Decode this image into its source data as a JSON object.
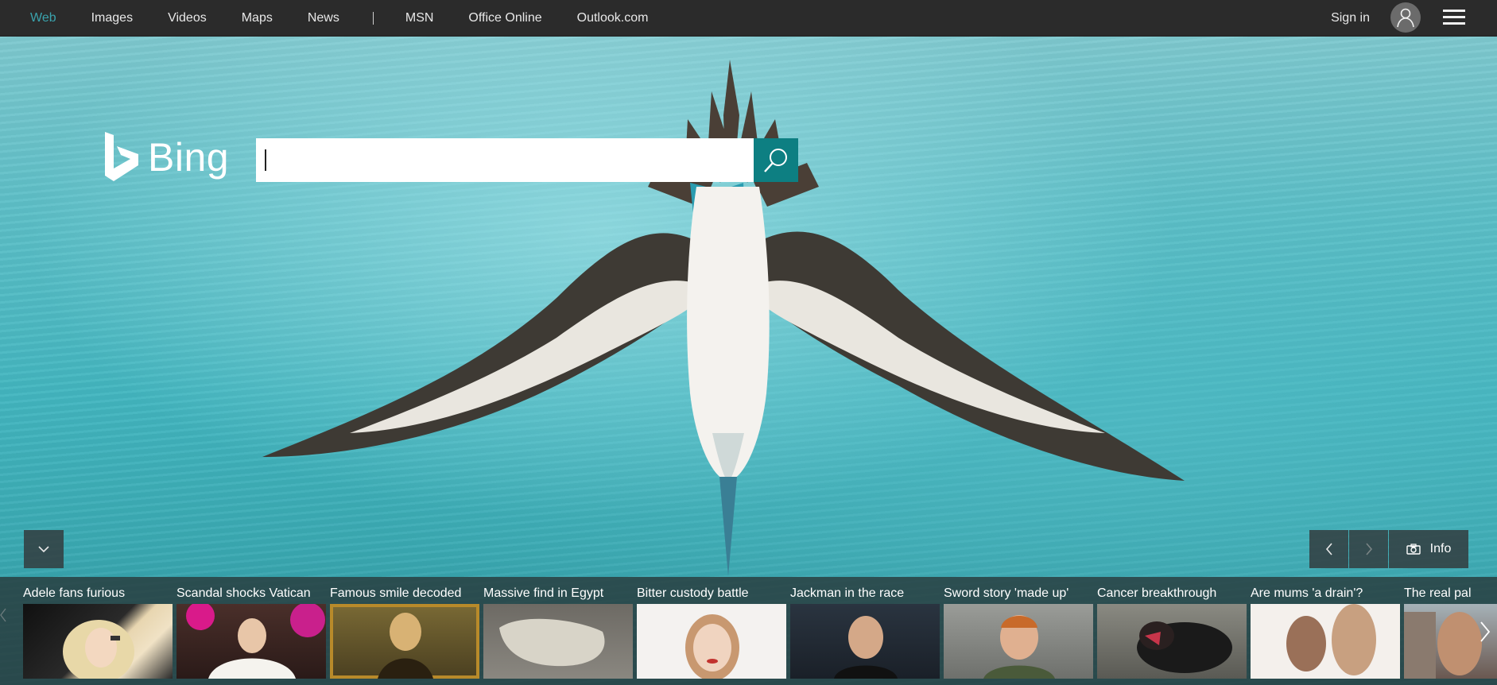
{
  "nav": {
    "items": [
      {
        "label": "Web",
        "active": true
      },
      {
        "label": "Images"
      },
      {
        "label": "Videos"
      },
      {
        "label": "Maps"
      },
      {
        "label": "News"
      }
    ],
    "extra": [
      {
        "label": "MSN"
      },
      {
        "label": "Office Online"
      },
      {
        "label": "Outlook.com"
      }
    ],
    "signin_label": "Sign in"
  },
  "logo": {
    "text": "Bing"
  },
  "search": {
    "value": "",
    "placeholder": ""
  },
  "image_controls": {
    "info_label": "Info"
  },
  "news": [
    {
      "title": "Adele fans furious"
    },
    {
      "title": "Scandal shocks Vatican"
    },
    {
      "title": "Famous smile decoded"
    },
    {
      "title": "Massive find in Egypt"
    },
    {
      "title": "Bitter custody battle"
    },
    {
      "title": "Jackman in the race"
    },
    {
      "title": "Sword story 'made up'"
    },
    {
      "title": "Cancer breakthrough"
    },
    {
      "title": "Are mums 'a drain'?"
    },
    {
      "title": "The real pal"
    }
  ],
  "colors": {
    "accent": "#0d7f82",
    "nav_active": "#3aa3ad",
    "topbar": "#2b2b2b"
  },
  "icons": [
    "menu-icon",
    "user-icon",
    "search-icon",
    "chevron-down-icon",
    "chevron-left-icon",
    "chevron-right-icon",
    "camera-icon"
  ]
}
